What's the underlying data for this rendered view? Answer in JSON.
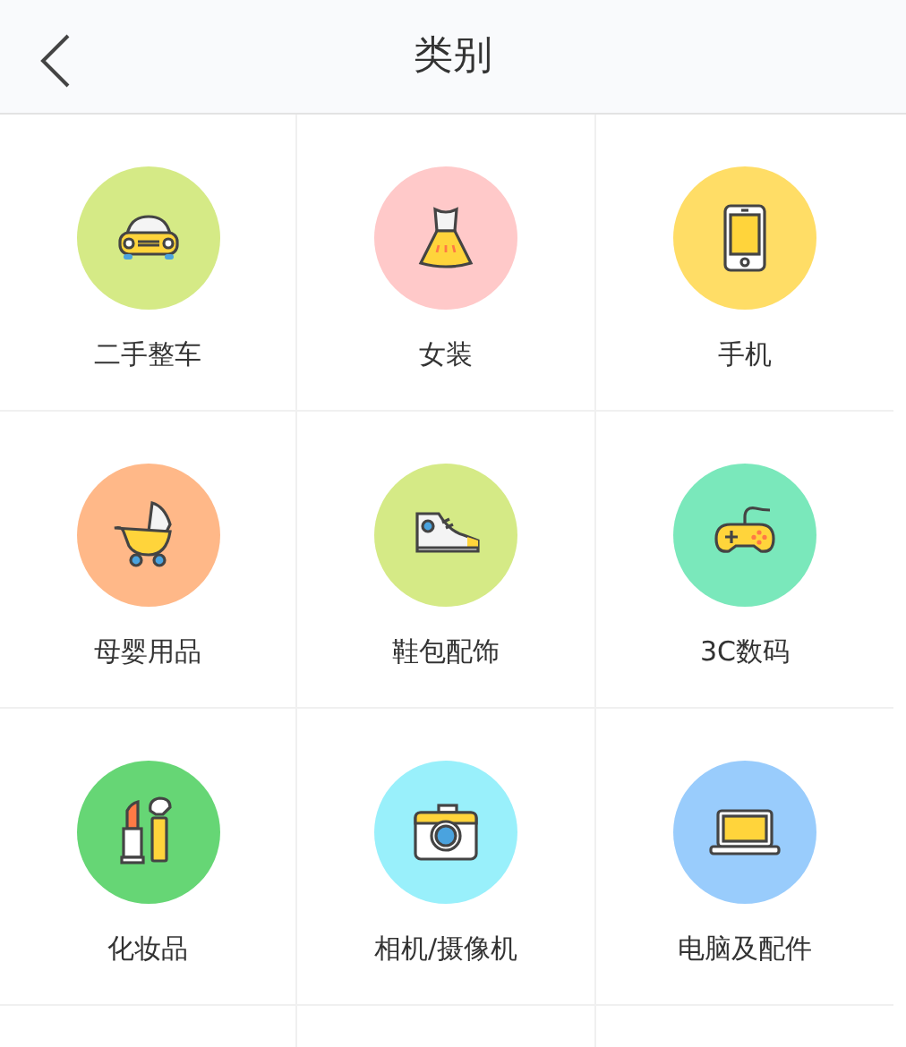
{
  "header": {
    "title": "类别"
  },
  "categories": [
    {
      "label": "二手整车",
      "kind": "car",
      "color": "#d5ea86"
    },
    {
      "label": "女装",
      "kind": "dress",
      "color": "#ffc9c9"
    },
    {
      "label": "手机",
      "kind": "phone",
      "color": "#ffdd66"
    },
    {
      "label": "母婴用品",
      "kind": "stroller",
      "color": "#ffb888"
    },
    {
      "label": "鞋包配饰",
      "kind": "sneaker",
      "color": "#d5ea86"
    },
    {
      "label": "3C数码",
      "kind": "gamepad",
      "color": "#7ae8bb"
    },
    {
      "label": "化妆品",
      "kind": "cosmetics",
      "color": "#66d675"
    },
    {
      "label": "相机/摄像机",
      "kind": "camera",
      "color": "#99f0fb"
    },
    {
      "label": "电脑及配件",
      "kind": "laptop",
      "color": "#99ccfc"
    }
  ]
}
